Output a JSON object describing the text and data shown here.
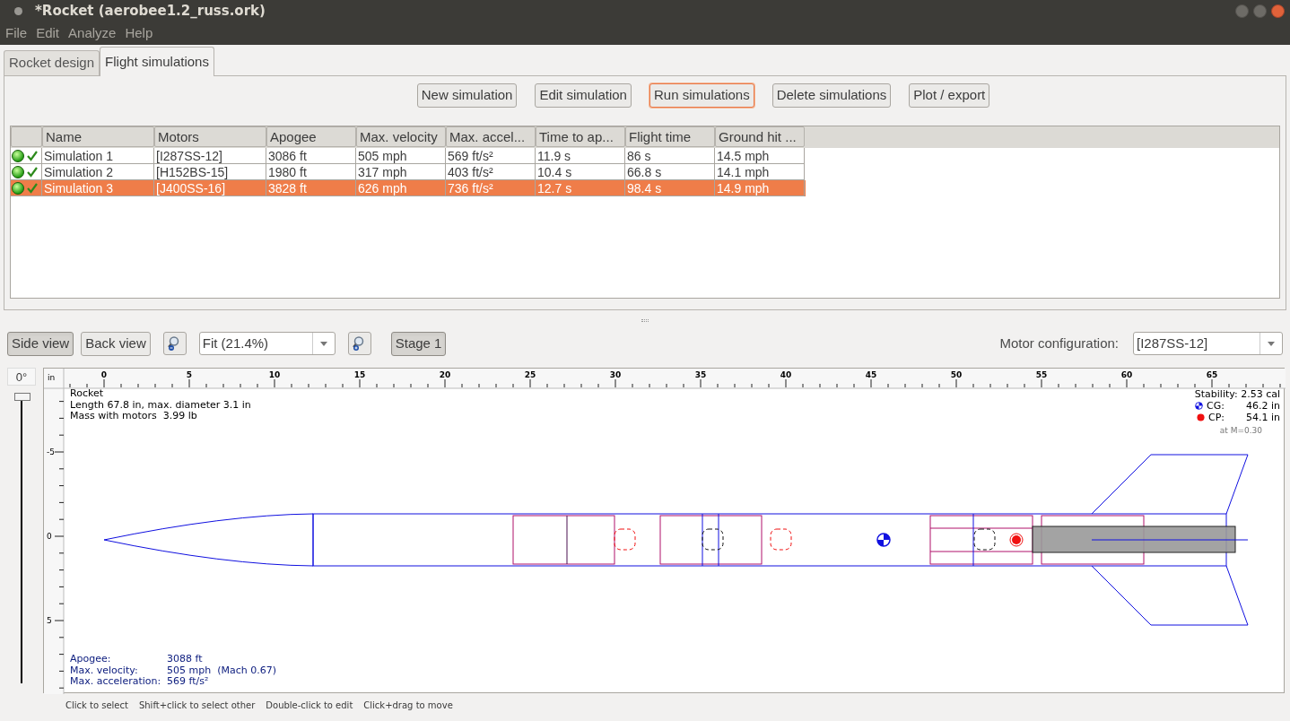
{
  "window": {
    "title": "*Rocket (aerobee1.2_russ.ork)"
  },
  "menu": [
    "File",
    "Edit",
    "Analyze",
    "Help"
  ],
  "tabs": [
    {
      "label": "Rocket design",
      "selected": false
    },
    {
      "label": "Flight simulations",
      "selected": true
    }
  ],
  "sim_buttons": [
    {
      "label": "New simulation",
      "focused": false
    },
    {
      "label": "Edit simulation",
      "focused": false
    },
    {
      "label": "Run simulations",
      "focused": true
    },
    {
      "label": "Delete simulations",
      "focused": false
    },
    {
      "label": "Plot / export",
      "focused": false
    }
  ],
  "table": {
    "columns": [
      "Name",
      "Motors",
      "Apogee",
      "Max. velocity",
      "Max. accel...",
      "Time to ap...",
      "Flight time",
      "Ground hit ..."
    ],
    "rows": [
      {
        "selected": false,
        "cells": [
          "Simulation 1",
          "[I287SS-12]",
          "3086 ft",
          "505 mph",
          "569 ft/s²",
          "11.9 s",
          "86 s",
          "14.5 mph"
        ]
      },
      {
        "selected": false,
        "cells": [
          "Simulation 2",
          "[H152BS-15]",
          "1980 ft",
          "317 mph",
          "403 ft/s²",
          "10.4 s",
          "66.8 s",
          "14.1 mph"
        ]
      },
      {
        "selected": true,
        "cells": [
          "Simulation 3",
          "[J400SS-16]",
          "3828 ft",
          "626 mph",
          "736 ft/s²",
          "12.7 s",
          "98.4 s",
          "14.9 mph"
        ]
      }
    ]
  },
  "view_toolbar": {
    "views": [
      {
        "label": "Side view",
        "selected": true
      },
      {
        "label": "Back view",
        "selected": false
      }
    ],
    "zoom": "Fit (21.4%)",
    "stage": {
      "label": "Stage 1",
      "selected": true
    },
    "motor_config_label": "Motor configuration:",
    "motor_config": "[I287SS-12]"
  },
  "rotation": {
    "reading": "0°",
    "level": 1
  },
  "ruler": {
    "unit": "in",
    "x_labels": [
      "0",
      "5",
      "10",
      "15",
      "20",
      "25",
      "30",
      "35",
      "40",
      "45",
      "50",
      "55",
      "60",
      "65"
    ],
    "y_labels": [
      "-5",
      "0",
      "5"
    ]
  },
  "info": {
    "lines": [
      "Rocket",
      "Length 67.8 in, max. diameter 3.1 in",
      "Mass with motors  3.99 lb"
    ],
    "stability": "Stability: 2.53 cal",
    "cg": {
      "label": "CG:",
      "value": "46.2 in"
    },
    "cp": {
      "label": "CP:",
      "value": "54.1 in"
    },
    "mach": "at M=0.30"
  },
  "flight": [
    {
      "label": "Apogee:",
      "value": "3088 ft"
    },
    {
      "label": "Max. velocity:",
      "value": "505 mph  (Mach 0.67)"
    },
    {
      "label": "Max. acceleration:",
      "value": "569 ft/s²"
    }
  ],
  "hints": [
    "Click to select",
    "Shift+click to select other",
    "Double-click to edit",
    "Click+drag to move"
  ]
}
